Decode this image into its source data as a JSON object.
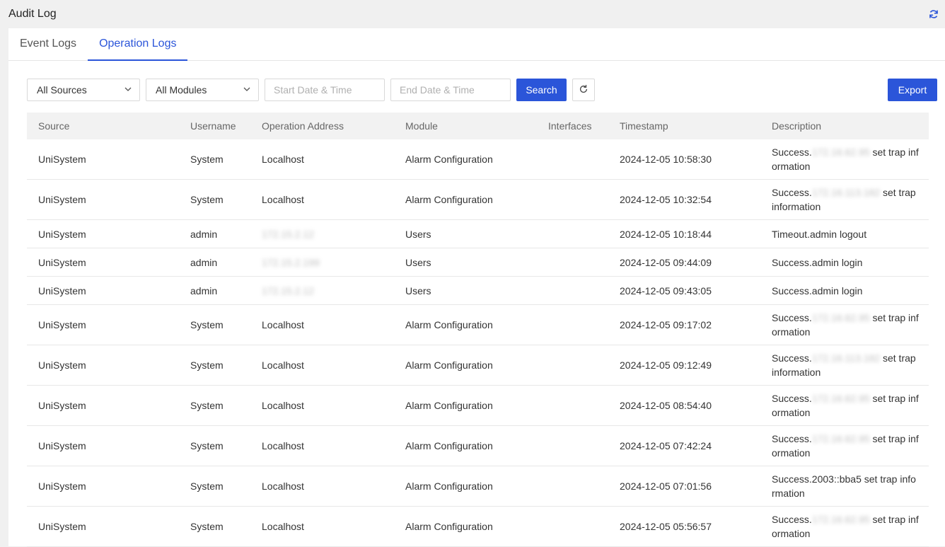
{
  "header": {
    "title": "Audit Log"
  },
  "tabs": [
    {
      "label": "Event Logs",
      "active": false
    },
    {
      "label": "Operation Logs",
      "active": true
    }
  ],
  "toolbar": {
    "source_select": "All Sources",
    "module_select": "All Modules",
    "start_placeholder": "Start Date & Time",
    "end_placeholder": "End Date & Time",
    "search_label": "Search",
    "export_label": "Export"
  },
  "columns": [
    "Source",
    "Username",
    "Operation Address",
    "Module",
    "Interfaces",
    "Timestamp",
    "Description"
  ],
  "rows": [
    {
      "source": "UniSystem",
      "username": "System",
      "address": "Localhost",
      "module": "Alarm Configuration",
      "interfaces": "",
      "timestamp": "2024-12-05 10:58:30",
      "desc_pre": "Success.",
      "desc_blur": "172.16.62.95",
      "desc_post": " set trap information",
      "size": "tall"
    },
    {
      "source": "UniSystem",
      "username": "System",
      "address": "Localhost",
      "module": "Alarm Configuration",
      "interfaces": "",
      "timestamp": "2024-12-05 10:32:54",
      "desc_pre": "Success.",
      "desc_blur": "172.16.113.182",
      "desc_post": " set trap information",
      "size": "tall"
    },
    {
      "source": "UniSystem",
      "username": "admin",
      "address_blur": "172.15.2.12",
      "module": "Users",
      "interfaces": "",
      "timestamp": "2024-12-05 10:18:44",
      "desc_pre": "Timeout.admin logout",
      "size": "short"
    },
    {
      "source": "UniSystem",
      "username": "admin",
      "address_blur": "172.15.2.199",
      "module": "Users",
      "interfaces": "",
      "timestamp": "2024-12-05 09:44:09",
      "desc_pre": "Success.admin login",
      "size": "short"
    },
    {
      "source": "UniSystem",
      "username": "admin",
      "address_blur": "172.15.2.12",
      "module": "Users",
      "interfaces": "",
      "timestamp": "2024-12-05 09:43:05",
      "desc_pre": "Success.admin login",
      "size": "short"
    },
    {
      "source": "UniSystem",
      "username": "System",
      "address": "Localhost",
      "module": "Alarm Configuration",
      "interfaces": "",
      "timestamp": "2024-12-05 09:17:02",
      "desc_pre": "Success.",
      "desc_blur": "172.16.62.95",
      "desc_post": " set trap information",
      "size": "tall"
    },
    {
      "source": "UniSystem",
      "username": "System",
      "address": "Localhost",
      "module": "Alarm Configuration",
      "interfaces": "",
      "timestamp": "2024-12-05 09:12:49",
      "desc_pre": "Success.",
      "desc_blur": "172.16.113.182",
      "desc_post": " set trap information",
      "size": "tall"
    },
    {
      "source": "UniSystem",
      "username": "System",
      "address": "Localhost",
      "module": "Alarm Configuration",
      "interfaces": "",
      "timestamp": "2024-12-05 08:54:40",
      "desc_pre": "Success.",
      "desc_blur": "172.16.62.95",
      "desc_post": " set trap information",
      "size": "tall"
    },
    {
      "source": "UniSystem",
      "username": "System",
      "address": "Localhost",
      "module": "Alarm Configuration",
      "interfaces": "",
      "timestamp": "2024-12-05 07:42:24",
      "desc_pre": "Success.",
      "desc_blur": "172.16.62.95",
      "desc_post": " set trap information",
      "size": "tall"
    },
    {
      "source": "UniSystem",
      "username": "System",
      "address": "Localhost",
      "module": "Alarm Configuration",
      "interfaces": "",
      "timestamp": "2024-12-05 07:01:56",
      "desc_pre": "Success.2003::bba5 set trap information",
      "size": "tall"
    },
    {
      "source": "UniSystem",
      "username": "System",
      "address": "Localhost",
      "module": "Alarm Configuration",
      "interfaces": "",
      "timestamp": "2024-12-05 05:56:57",
      "desc_pre": "Success.",
      "desc_blur": "172.16.62.95",
      "desc_post": " set trap information",
      "size": "tall"
    }
  ]
}
